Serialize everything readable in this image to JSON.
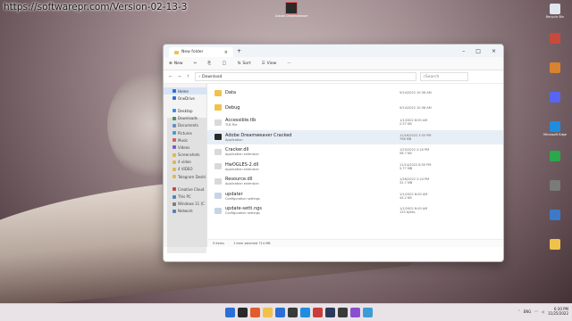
{
  "watermark": "https://softwarepr.com/Version-02-13-3",
  "desktop_app": {
    "label": "Adobe Dreamweaver",
    "icon": "dreamweaver-app-icon"
  },
  "window": {
    "tab_title": "New folder",
    "toolbar": {
      "new": "New",
      "sort": "Sort",
      "view": "View"
    },
    "address": {
      "path": "Download",
      "search_placeholder": "Search"
    },
    "nav": [
      {
        "label": "Home",
        "icon": "home-icon",
        "color": "#2b6fd6",
        "selected": true
      },
      {
        "label": "OneDrive",
        "icon": "cloud-icon",
        "color": "#2b6fd6"
      },
      {
        "label": "Desktop",
        "icon": "desktop-icon",
        "color": "#3e8ee6"
      },
      {
        "label": "Downloads",
        "icon": "download-icon",
        "color": "#2a9d5a"
      },
      {
        "label": "Documents",
        "icon": "document-icon",
        "color": "#5a8fd6"
      },
      {
        "label": "Pictures",
        "icon": "picture-icon",
        "color": "#3da0d8"
      },
      {
        "label": "Music",
        "icon": "music-icon",
        "color": "#e0574f"
      },
      {
        "label": "Videos",
        "icon": "video-icon",
        "color": "#7d54c7"
      },
      {
        "label": "Screenshots",
        "icon": "folder-icon",
        "color": "#f1c24b"
      },
      {
        "label": "4 video",
        "icon": "folder-icon",
        "color": "#f1c24b"
      },
      {
        "label": "4 VIDEO",
        "icon": "folder-icon",
        "color": "#f1c24b"
      },
      {
        "label": "Telegram Deskt",
        "icon": "folder-icon",
        "color": "#f1c24b"
      },
      {
        "label": "Creative Cloud",
        "icon": "cloud-icon",
        "color": "#d13a3a"
      },
      {
        "label": "This PC",
        "icon": "pc-icon",
        "color": "#4a7fc1"
      },
      {
        "label": "Windows 11 (C",
        "icon": "drive-icon",
        "color": "#7a7a7a"
      },
      {
        "label": "Network",
        "icon": "network-icon",
        "color": "#4a7fc1"
      }
    ],
    "files": [
      {
        "name": "Data",
        "type": "",
        "size": "",
        "date": "9/14/2022 10:36 AM",
        "icon_color": "#f1c24b"
      },
      {
        "name": "Debug",
        "type": "",
        "size": "",
        "date": "9/14/2022 10:36 AM",
        "icon_color": "#f1c24b"
      },
      {
        "name": "Accessible.tlb",
        "type": "TLB File",
        "size": "2.57 KB",
        "date": "1/1/2002 8:00 AM",
        "icon_color": "#d9d9d9"
      },
      {
        "name": "Adobe Dreamweaver Cracked",
        "type": "Application",
        "size": "798 MB",
        "date": "11/16/2022 3:33 PM",
        "icon_color": "#2a2a2a",
        "selected": true
      },
      {
        "name": "Cracker.dll",
        "type": "Application extension",
        "size": "58.7 KB",
        "date": "1/25/2022 2:20 PM",
        "icon_color": "#d9d9d9"
      },
      {
        "name": "HwOGLES-2.dll",
        "type": "Application extension",
        "size": "5.77 MB",
        "date": "11/14/2022 8:55 PM",
        "icon_color": "#d9d9d9"
      },
      {
        "name": "Resource.dll",
        "type": "Application extension",
        "size": "32.7 MB",
        "date": "1/26/2022 2:24 PM",
        "icon_color": "#d9d9d9"
      },
      {
        "name": "updater",
        "type": "Configuration settings",
        "size": "44.2 KB",
        "date": "1/1/2002 8:00 AM",
        "icon_color": "#c6d4e6"
      },
      {
        "name": "update-setti.ngs",
        "type": "Configuration settings",
        "size": "125 bytes",
        "date": "1/1/2002 8:00 AM",
        "icon_color": "#c6d4e6"
      }
    ],
    "meta_labels": {
      "date": "Date modified:",
      "size": "Size:",
      "type": "Type:"
    },
    "status": {
      "items": "9 items",
      "selected": "1 item selected  714 MB"
    }
  },
  "right_icons": [
    {
      "label": "Recycle Bin",
      "color": "#dfe6ee"
    },
    {
      "label": "",
      "color": "#c94a3c"
    },
    {
      "label": "",
      "color": "#d8832e"
    },
    {
      "label": "",
      "color": "#5865f2"
    },
    {
      "label": "Microsoft Edge",
      "color": "#1f8ce0"
    },
    {
      "label": "",
      "color": "#2aa84a"
    },
    {
      "label": "",
      "color": "#7a7a7a"
    },
    {
      "label": "",
      "color": "#3c7ac9"
    },
    {
      "label": "",
      "color": "#f1c24b"
    }
  ],
  "taskbar": {
    "apps": [
      "#2b6fd6",
      "#2a2a2a",
      "#e05c2c",
      "#f1c24b",
      "#2b6fd6",
      "#3a3a3a",
      "#1f8ce0",
      "#c93c3c",
      "#2b3a5a",
      "#3a3a3a",
      "#8a4fd0",
      "#3c9cd6"
    ],
    "tray": {
      "lang": "ENG",
      "time": "6:30 PM",
      "date": "11/25/2022"
    }
  }
}
